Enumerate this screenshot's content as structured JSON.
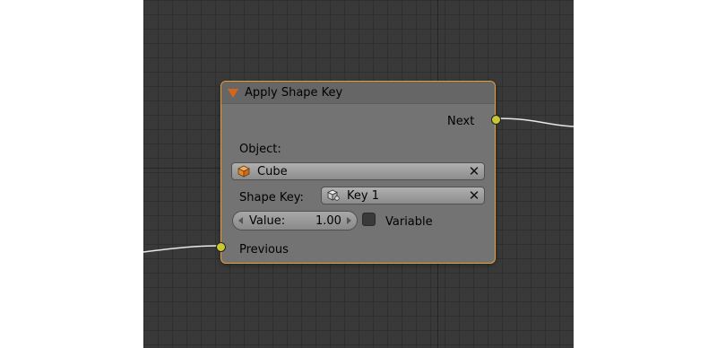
{
  "node": {
    "title": "Apply Shape Key",
    "output_socket_label": "Next",
    "input_socket_label": "Previous",
    "object_label": "Object:",
    "object_value": "Cube",
    "shape_key_label": "Shape Key:",
    "shape_key_value": "Key 1",
    "value_label": "Value:",
    "value_number": "1.00",
    "variable_label": "Variable",
    "variable_checked": false
  },
  "colors": {
    "node_border": "#e8a030",
    "socket": "#c8c832",
    "collapse_arrow": "#d8641a",
    "background": "#393939"
  },
  "icons": {
    "collapse": "triangle-down-icon",
    "object": "cube-icon",
    "shape_key": "shape-key-icon",
    "clear": "x-icon"
  }
}
